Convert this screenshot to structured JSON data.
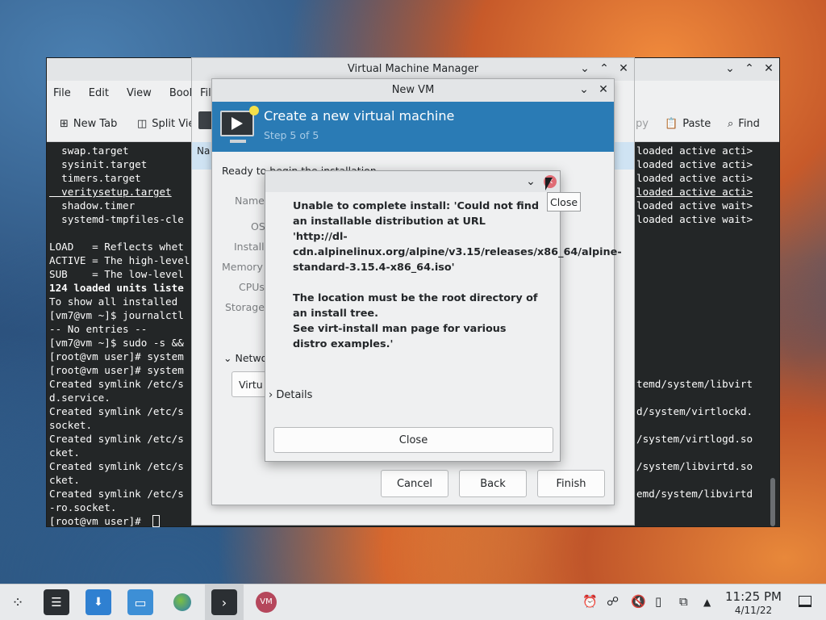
{
  "terminal": {
    "menu": [
      "File",
      "Edit",
      "View",
      "Bookr",
      "File"
    ],
    "toolbar": {
      "new_tab": "New Tab",
      "split_view": "Split Vie",
      "copy": "py",
      "paste": "Paste",
      "find": "Find"
    },
    "left_lines": [
      "  swap.target",
      "  sysinit.target",
      "  timers.target",
      "  veritysetup.target",
      "  shadow.timer",
      "  systemd-tmpfiles-cle",
      "",
      "LOAD   = Reflects whet",
      "ACTIVE = The high-level",
      "SUB    = The low-level",
      "124 loaded units liste",
      "To show all installed",
      "[vm7@vm ~]$ journalctl",
      "-- No entries --",
      "[vm7@vm ~]$ sudo -s &&",
      "[root@vm user]# system",
      "[root@vm user]# system",
      "Created symlink /etc/s",
      "d.service.",
      "Created symlink /etc/s",
      "socket.",
      "Created symlink /etc/s",
      "cket.",
      "Created symlink /etc/s",
      "cket.",
      "Created symlink /etc/s",
      "-ro.socket.",
      "[root@vm user]# "
    ],
    "right_lines": [
      "loaded active acti>",
      "loaded active acti>",
      "loaded active acti>",
      "loaded active acti>",
      "loaded active wait>",
      "loaded active wait>",
      "",
      "",
      "",
      "",
      "",
      "",
      "",
      "",
      "",
      "",
      "",
      "temd/system/libvirt",
      "",
      "d/system/virtlockd.",
      "",
      "/system/virtlogd.so",
      "",
      "/system/libvirtd.so",
      "",
      "emd/system/libvirtd"
    ]
  },
  "vmm": {
    "title": "Virtual Machine Manager"
  },
  "newvm": {
    "title": "New VM",
    "header_title": "Create a new virtual machine",
    "header_step": "Step 5 of 5",
    "ready_text": "Ready to begin the installation",
    "labels": [
      "Name",
      "OS",
      "Install",
      "Memory",
      "CPUs",
      "Storage"
    ],
    "network_label": "Netwo",
    "network_value": "Virtu",
    "buttons": {
      "cancel": "Cancel",
      "back": "Back",
      "finish": "Finish"
    }
  },
  "error_dialog": {
    "message": "Unable to complete install: 'Could not find an installable distribution at URL 'http://dl-cdn.alpinelinux.org/alpine/v3.15/releases/x86_64/alpine-standard-3.15.4-x86_64.iso'\n\nThe location must be the root directory of an install tree.\nSee virt-install man page for various distro examples.'",
    "details_label": "Details",
    "close_button": "Close",
    "tooltip": "Close"
  },
  "taskbar": {
    "time": "11:25 PM",
    "date": "4/11/22"
  },
  "colors": {
    "accent": "#2a7bb5",
    "terminal_bg": "#232627"
  }
}
